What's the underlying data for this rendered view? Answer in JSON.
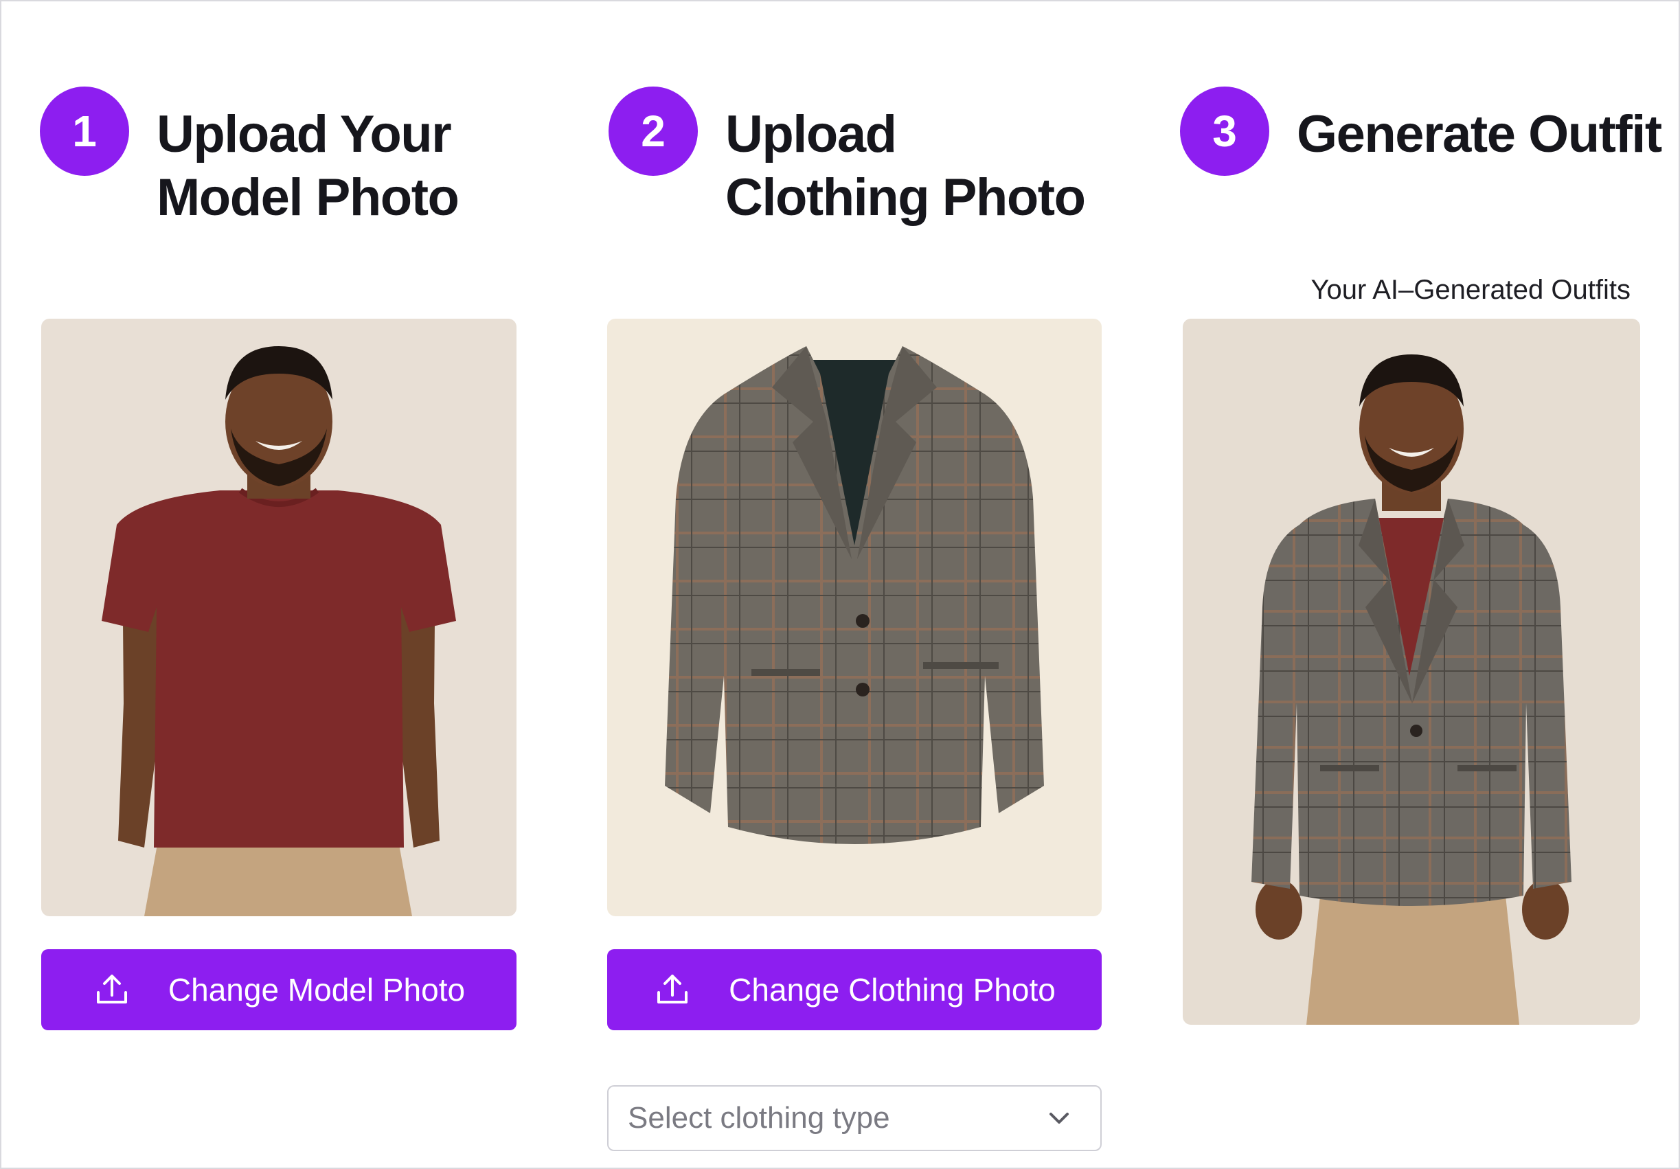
{
  "steps": [
    {
      "number": "1",
      "title": "Upload Your Model Photo"
    },
    {
      "number": "2",
      "title": "Upload Clothing Photo"
    },
    {
      "number": "3",
      "title": "Generate Outfit"
    }
  ],
  "result": {
    "caption": "Your AI–Generated Outfits"
  },
  "buttons": {
    "change_model": "Change Model Photo",
    "change_clothing": "Change Clothing Photo"
  },
  "clothing_type_select": {
    "placeholder": "Select clothing type"
  },
  "icons": {
    "upload": "upload-icon",
    "dropdown": "chevron-down-icon"
  },
  "colors": {
    "accent": "#8d1ef0",
    "button_text": "#ffffff",
    "heading": "#16161c",
    "placeholder": "#7a7a82"
  }
}
